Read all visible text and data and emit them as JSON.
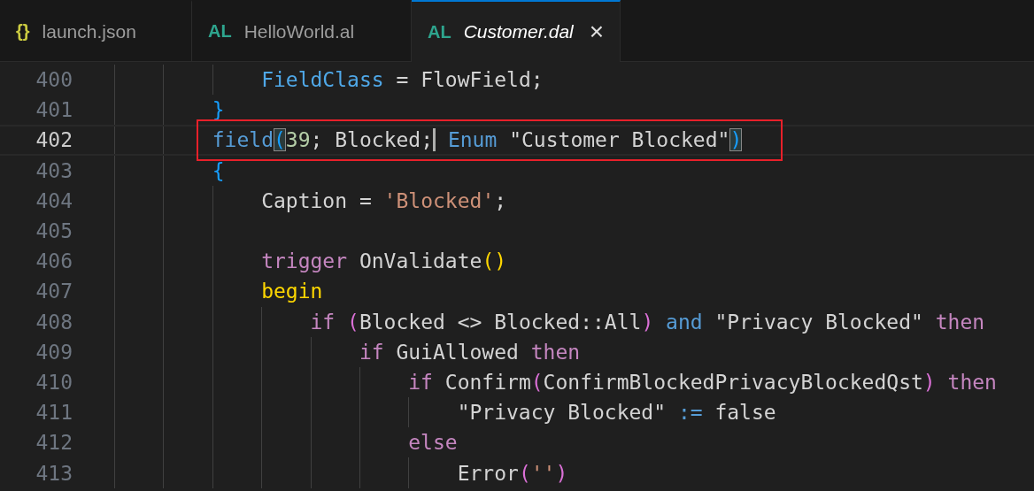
{
  "tabs": [
    {
      "icon": "{}",
      "color": "#cbcb41",
      "label": "launch.json",
      "selected": false,
      "preview": false
    },
    {
      "icon": "AL",
      "color": "#2ea58e",
      "label": "HelloWorld.al",
      "selected": false,
      "preview": false
    },
    {
      "icon": "AL",
      "color": "#2ea58e",
      "label": "Customer.dal",
      "selected": true,
      "preview": true,
      "close": "×"
    }
  ],
  "editor": {
    "lines": [
      {
        "number": "400",
        "indent": [
          {
            "guide": true
          },
          {
            "guide": true
          },
          {
            "guide": true
          }
        ],
        "current": false,
        "annotated": false,
        "tokens": [
          {
            "text": "FieldClass",
            "kind": "prop"
          },
          {
            "text": " = FlowField;",
            "kind": "ident"
          }
        ]
      },
      {
        "number": "401",
        "indent": [
          {
            "guide": true
          },
          {
            "guide": true
          }
        ],
        "current": false,
        "annotated": false,
        "tokens": [
          {
            "text": "}",
            "kind": "bracket3"
          }
        ]
      },
      {
        "number": "402",
        "indent": [
          {
            "guide": true
          },
          {
            "guide": true
          }
        ],
        "current": true,
        "annotated": true,
        "tokens": [
          {
            "text": "field",
            "kind": "kw"
          },
          {
            "text": "(",
            "kind": "bracket3",
            "matched": true
          },
          {
            "text": "39",
            "kind": "num"
          },
          {
            "text": "; Blocked;",
            "kind": "ident",
            "cursor": true
          },
          {
            "text": " Enum",
            "kind": "kw"
          },
          {
            "text": " \"Customer Blocked\"",
            "kind": "ident"
          },
          {
            "text": ")",
            "kind": "bracket3",
            "matched": true
          }
        ]
      },
      {
        "number": "403",
        "indent": [
          {
            "guide": true
          },
          {
            "guide": true
          }
        ],
        "current": false,
        "annotated": false,
        "tokens": [
          {
            "text": "{",
            "kind": "bracket3"
          }
        ]
      },
      {
        "number": "404",
        "indent": [
          {
            "guide": true
          },
          {
            "guide": true
          },
          {
            "guide": true
          }
        ],
        "current": false,
        "annotated": false,
        "tokens": [
          {
            "text": "Caption = ",
            "kind": "ident"
          },
          {
            "text": "'Blocked'",
            "kind": "str"
          },
          {
            "text": ";",
            "kind": "ident"
          }
        ]
      },
      {
        "number": "405",
        "indent": [
          {
            "guide": true
          },
          {
            "guide": true
          },
          {
            "guide": true
          }
        ],
        "current": false,
        "annotated": false
      },
      {
        "number": "406",
        "indent": [
          {
            "guide": true
          },
          {
            "guide": true
          },
          {
            "guide": true
          }
        ],
        "current": false,
        "annotated": false,
        "tokens": [
          {
            "text": "trigger",
            "kind": "ctrl"
          },
          {
            "text": " OnValidate",
            "kind": "ident"
          },
          {
            "text": "()",
            "kind": "bracket1"
          }
        ]
      },
      {
        "number": "407",
        "indent": [
          {
            "guide": true
          },
          {
            "guide": true
          },
          {
            "guide": true
          }
        ],
        "current": false,
        "annotated": false,
        "tokens": [
          {
            "text": "begin",
            "kind": "begin"
          }
        ]
      },
      {
        "number": "408",
        "indent": [
          {
            "guide": true
          },
          {
            "guide": true
          },
          {
            "guide": true
          },
          {
            "guide": true
          }
        ],
        "current": false,
        "annotated": false,
        "tokens": [
          {
            "text": "if",
            "kind": "ctrl"
          },
          {
            "text": " (",
            "kind": "bracket2"
          },
          {
            "text": "Blocked <> Blocked::All",
            "kind": "ident"
          },
          {
            "text": ")",
            "kind": "bracket2"
          },
          {
            "text": " and",
            "kind": "kw"
          },
          {
            "text": " \"Privacy Blocked\"",
            "kind": "ident"
          },
          {
            "text": " then",
            "kind": "ctrl"
          }
        ]
      },
      {
        "number": "409",
        "indent": [
          {
            "guide": true
          },
          {
            "guide": true
          },
          {
            "guide": true
          },
          {
            "guide": true
          },
          {
            "guide": true
          }
        ],
        "current": false,
        "annotated": false,
        "tokens": [
          {
            "text": "if",
            "kind": "ctrl"
          },
          {
            "text": " GuiAllowed",
            "kind": "ident"
          },
          {
            "text": " then",
            "kind": "ctrl"
          }
        ]
      },
      {
        "number": "410",
        "indent": [
          {
            "guide": true
          },
          {
            "guide": true
          },
          {
            "guide": true
          },
          {
            "guide": true
          },
          {
            "guide": true
          },
          {
            "guide": true
          }
        ],
        "current": false,
        "annotated": false,
        "tokens": [
          {
            "text": "if",
            "kind": "ctrl"
          },
          {
            "text": " Confirm",
            "kind": "ident"
          },
          {
            "text": "(",
            "kind": "bracket2"
          },
          {
            "text": "ConfirmBlockedPrivacyBlockedQst",
            "kind": "ident"
          },
          {
            "text": ")",
            "kind": "bracket2"
          },
          {
            "text": " then",
            "kind": "ctrl"
          }
        ]
      },
      {
        "number": "411",
        "indent": [
          {
            "guide": true
          },
          {
            "guide": true
          },
          {
            "guide": true
          },
          {
            "guide": true
          },
          {
            "guide": true
          },
          {
            "guide": true
          },
          {
            "guide": true
          }
        ],
        "current": false,
        "annotated": false,
        "tokens": [
          {
            "text": "\"Privacy Blocked\"",
            "kind": "ident"
          },
          {
            "text": " :=",
            "kind": "kw"
          },
          {
            "text": " false",
            "kind": "ident"
          }
        ]
      },
      {
        "number": "412",
        "indent": [
          {
            "guide": true
          },
          {
            "guide": true
          },
          {
            "guide": true
          },
          {
            "guide": true
          },
          {
            "guide": true
          },
          {
            "guide": true
          }
        ],
        "current": false,
        "annotated": false,
        "tokens": [
          {
            "text": "else",
            "kind": "ctrl"
          }
        ]
      },
      {
        "number": "413",
        "indent": [
          {
            "guide": true
          },
          {
            "guide": true
          },
          {
            "guide": true
          },
          {
            "guide": true
          },
          {
            "guide": true
          },
          {
            "guide": true
          },
          {
            "guide": true
          }
        ],
        "current": false,
        "annotated": false,
        "tokens": [
          {
            "text": "Error",
            "kind": "ident"
          },
          {
            "text": "(",
            "kind": "bracket2"
          },
          {
            "text": "''",
            "kind": "str"
          },
          {
            "text": ")",
            "kind": "bracket2"
          }
        ]
      }
    ]
  }
}
